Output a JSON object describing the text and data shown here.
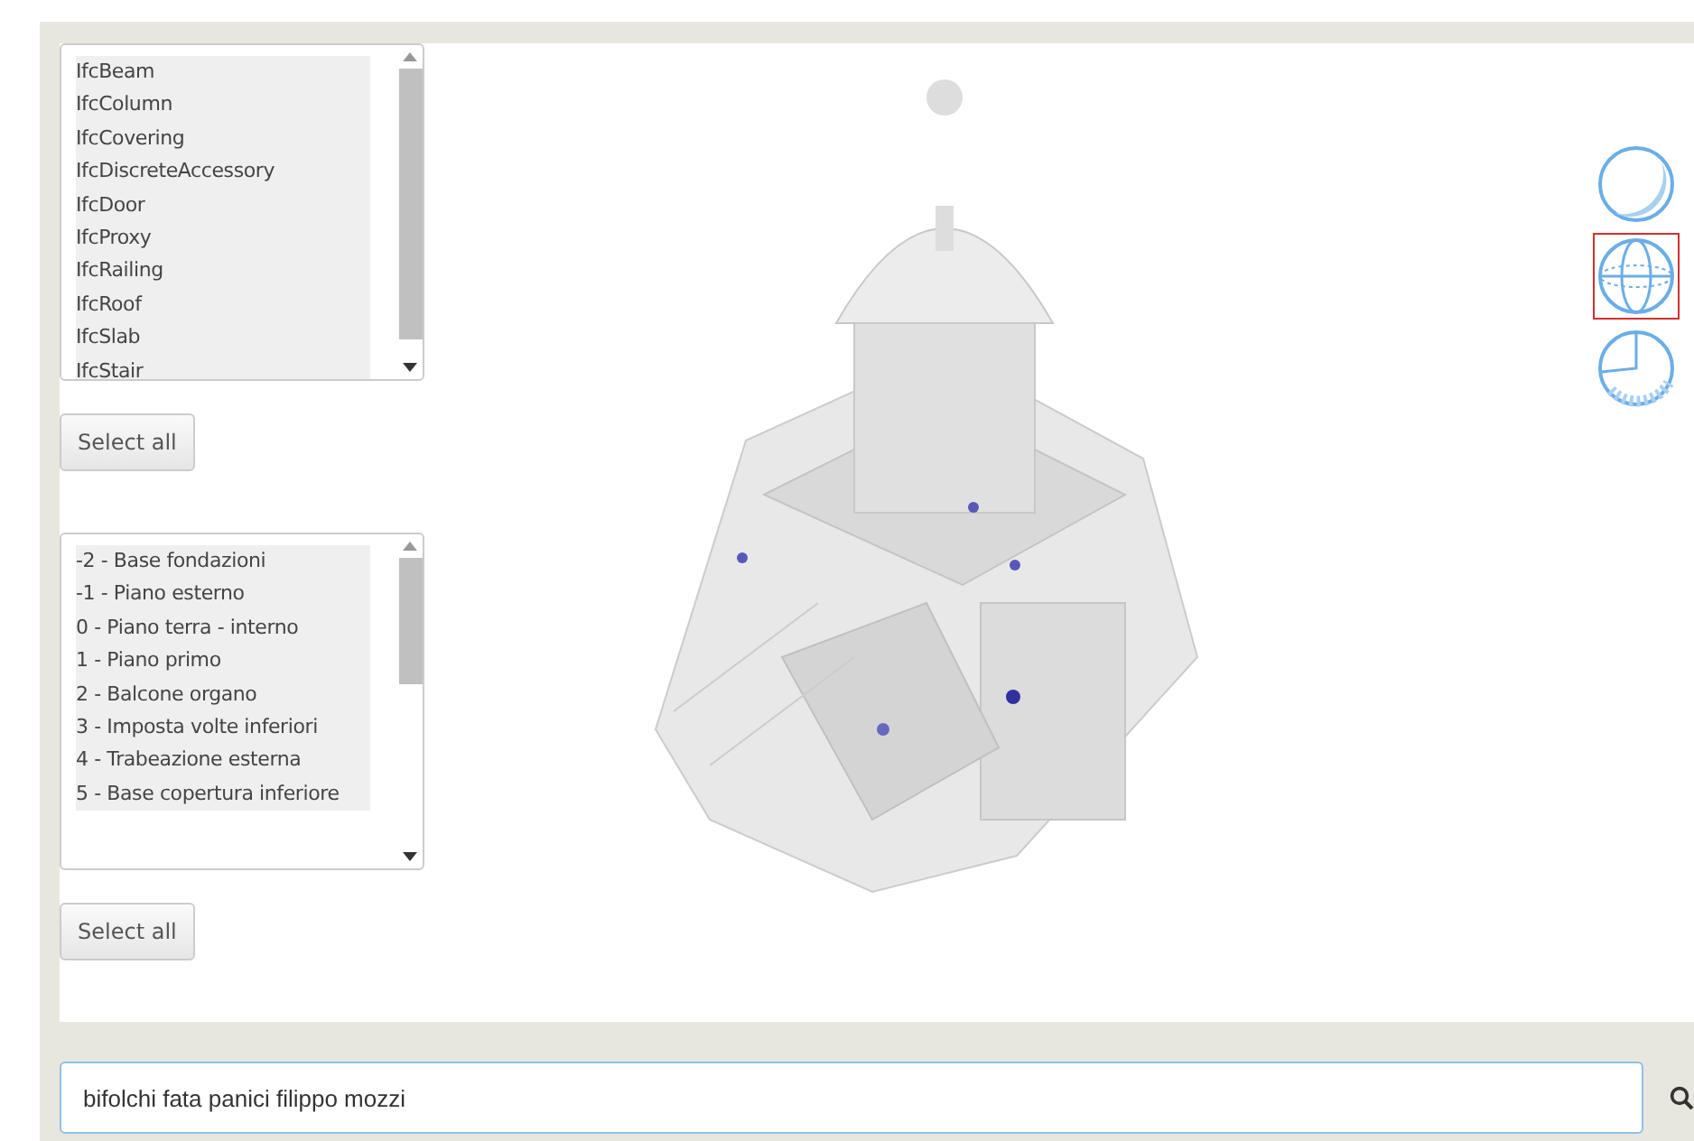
{
  "type_list": {
    "items": [
      {
        "label": "IfcBeam",
        "selected": true
      },
      {
        "label": "IfcColumn",
        "selected": true
      },
      {
        "label": "IfcCovering",
        "selected": true
      },
      {
        "label": "IfcDiscreteAccessory",
        "selected": true
      },
      {
        "label": "IfcDoor",
        "selected": true
      },
      {
        "label": "IfcProxy",
        "selected": true
      },
      {
        "label": "IfcRailing",
        "selected": true
      },
      {
        "label": "IfcRoof",
        "selected": true
      },
      {
        "label": "IfcSlab",
        "selected": true
      },
      {
        "label": "IfcStair",
        "selected": true
      }
    ],
    "button": "Select all"
  },
  "level_list": {
    "items": [
      {
        "label": "-2 - Base fondazioni",
        "selected": true
      },
      {
        "label": "-1 - Piano esterno",
        "selected": true
      },
      {
        "label": "0 - Piano terra - interno",
        "selected": true
      },
      {
        "label": "1 - Piano primo",
        "selected": true
      },
      {
        "label": "2 - Balcone organo",
        "selected": true
      },
      {
        "label": "3 - Imposta volte inferiori",
        "selected": true
      },
      {
        "label": "4 - Trabeazione esterna",
        "selected": true
      },
      {
        "label": "5 - Base copertura inferiore",
        "selected": true
      }
    ],
    "button": "Select all"
  },
  "view_modes": [
    {
      "kind": "shaded",
      "selected": false
    },
    {
      "kind": "wireframe",
      "selected": true
    },
    {
      "kind": "section",
      "selected": false
    }
  ],
  "search": {
    "value": "bifolchi fata panici filippo mozzi"
  }
}
